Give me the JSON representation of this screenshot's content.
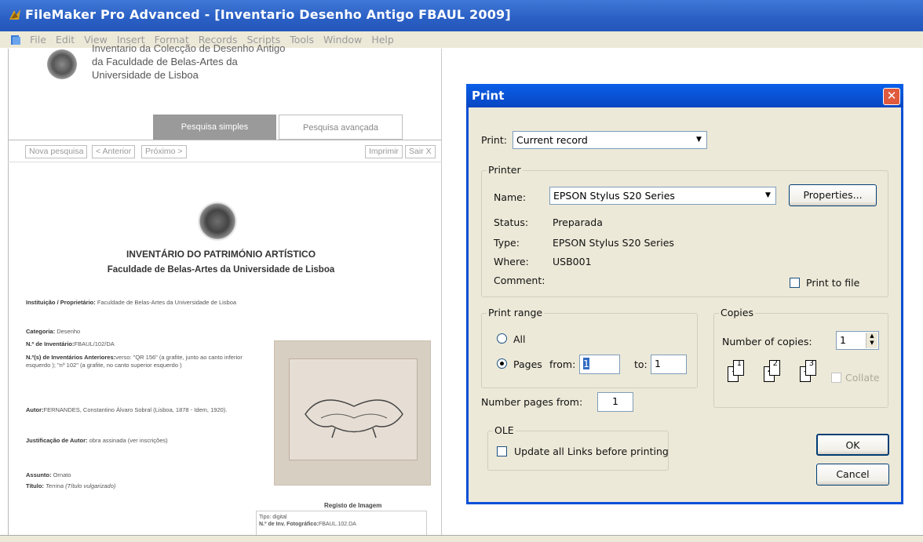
{
  "window": {
    "title": "FileMaker Pro Advanced - [Inventario Desenho Antigo FBAUL 2009]"
  },
  "menu": [
    "File",
    "Edit",
    "View",
    "Insert",
    "Format",
    "Records",
    "Scripts",
    "Tools",
    "Window",
    "Help"
  ],
  "page": {
    "header_lines": [
      "Inventario da Colecção de Desenho Antigo",
      "da Faculdade de Belas-Artes da",
      "Universidade de Lisboa"
    ],
    "tabs": {
      "simple": "Pesquisa simples",
      "advanced": "Pesquisa avançada"
    },
    "nav": {
      "new_search": "Nova pesquisa",
      "prev": "< Anterior",
      "next": "Próximo >",
      "print": "Imprimir",
      "exit": "Sair X"
    },
    "title1": "INVENTÁRIO DO PATRIMÓNIO ARTÍSTICO",
    "title2": "Faculdade de Belas-Artes da Universidade de Lisboa",
    "fields": {
      "owner_label": "Instituição / Proprietário:",
      "owner_value": "Faculdade de Belas-Artes da Universidade de Lisboa",
      "category_label": "Categoria:",
      "category_value": "Desenho",
      "inv_label": "N.º de Inventário:",
      "inv_value": "FBAUL/102/DA",
      "prev_inv_label": "N.º(s) de Inventários Anteriores:",
      "prev_inv_value": "verso: \"QR 156\" (a grafite, junto ao canto inferior esquerdo ); \"nº 102\" (a grafite, no canto superior esquerdo )",
      "author_label": "Autor:",
      "author_value": "FERNANDES, Constantino Álvaro Sobral (Lisboa, 1878 - Idem, 1920).",
      "just_label": "Justificação de Autor:",
      "just_value": "obra assinada (ver inscrições)",
      "subject_label": "Assunto:",
      "subject_value": "Ornato",
      "title_label": "Título:",
      "title_value": "Terrina (Título vulgarizado)"
    },
    "registo": {
      "title": "Registo de Imagem",
      "tipo_label": "Tipo:",
      "tipo_value": "digital",
      "foto_label": "N.º de Inv. Fotográfico:",
      "foto_value": "FBAUL.102.DA"
    }
  },
  "dialog": {
    "title": "Print",
    "print_label": "Print:",
    "print_value": "Current record",
    "printer_group": "Printer",
    "name_label": "Name:",
    "name_value": "EPSON Stylus S20 Series",
    "properties": "Properties...",
    "status_label": "Status:",
    "status_value": "Preparada",
    "type_label": "Type:",
    "type_value": "EPSON Stylus S20 Series",
    "where_label": "Where:",
    "where_value": "USB001",
    "comment_label": "Comment:",
    "print_to_file": "Print to file",
    "range_group": "Print range",
    "all": "All",
    "pages": "Pages",
    "from": "from:",
    "from_value": "1",
    "to": "to:",
    "to_value": "1",
    "copies_group": "Copies",
    "num_copies_label": "Number of copies:",
    "num_copies_value": "1",
    "collate": "Collate",
    "number_pages_from": "Number pages from:",
    "number_pages_value": "1",
    "ole_group": "OLE",
    "update_links": "Update all Links before printing",
    "ok": "OK",
    "cancel": "Cancel"
  }
}
